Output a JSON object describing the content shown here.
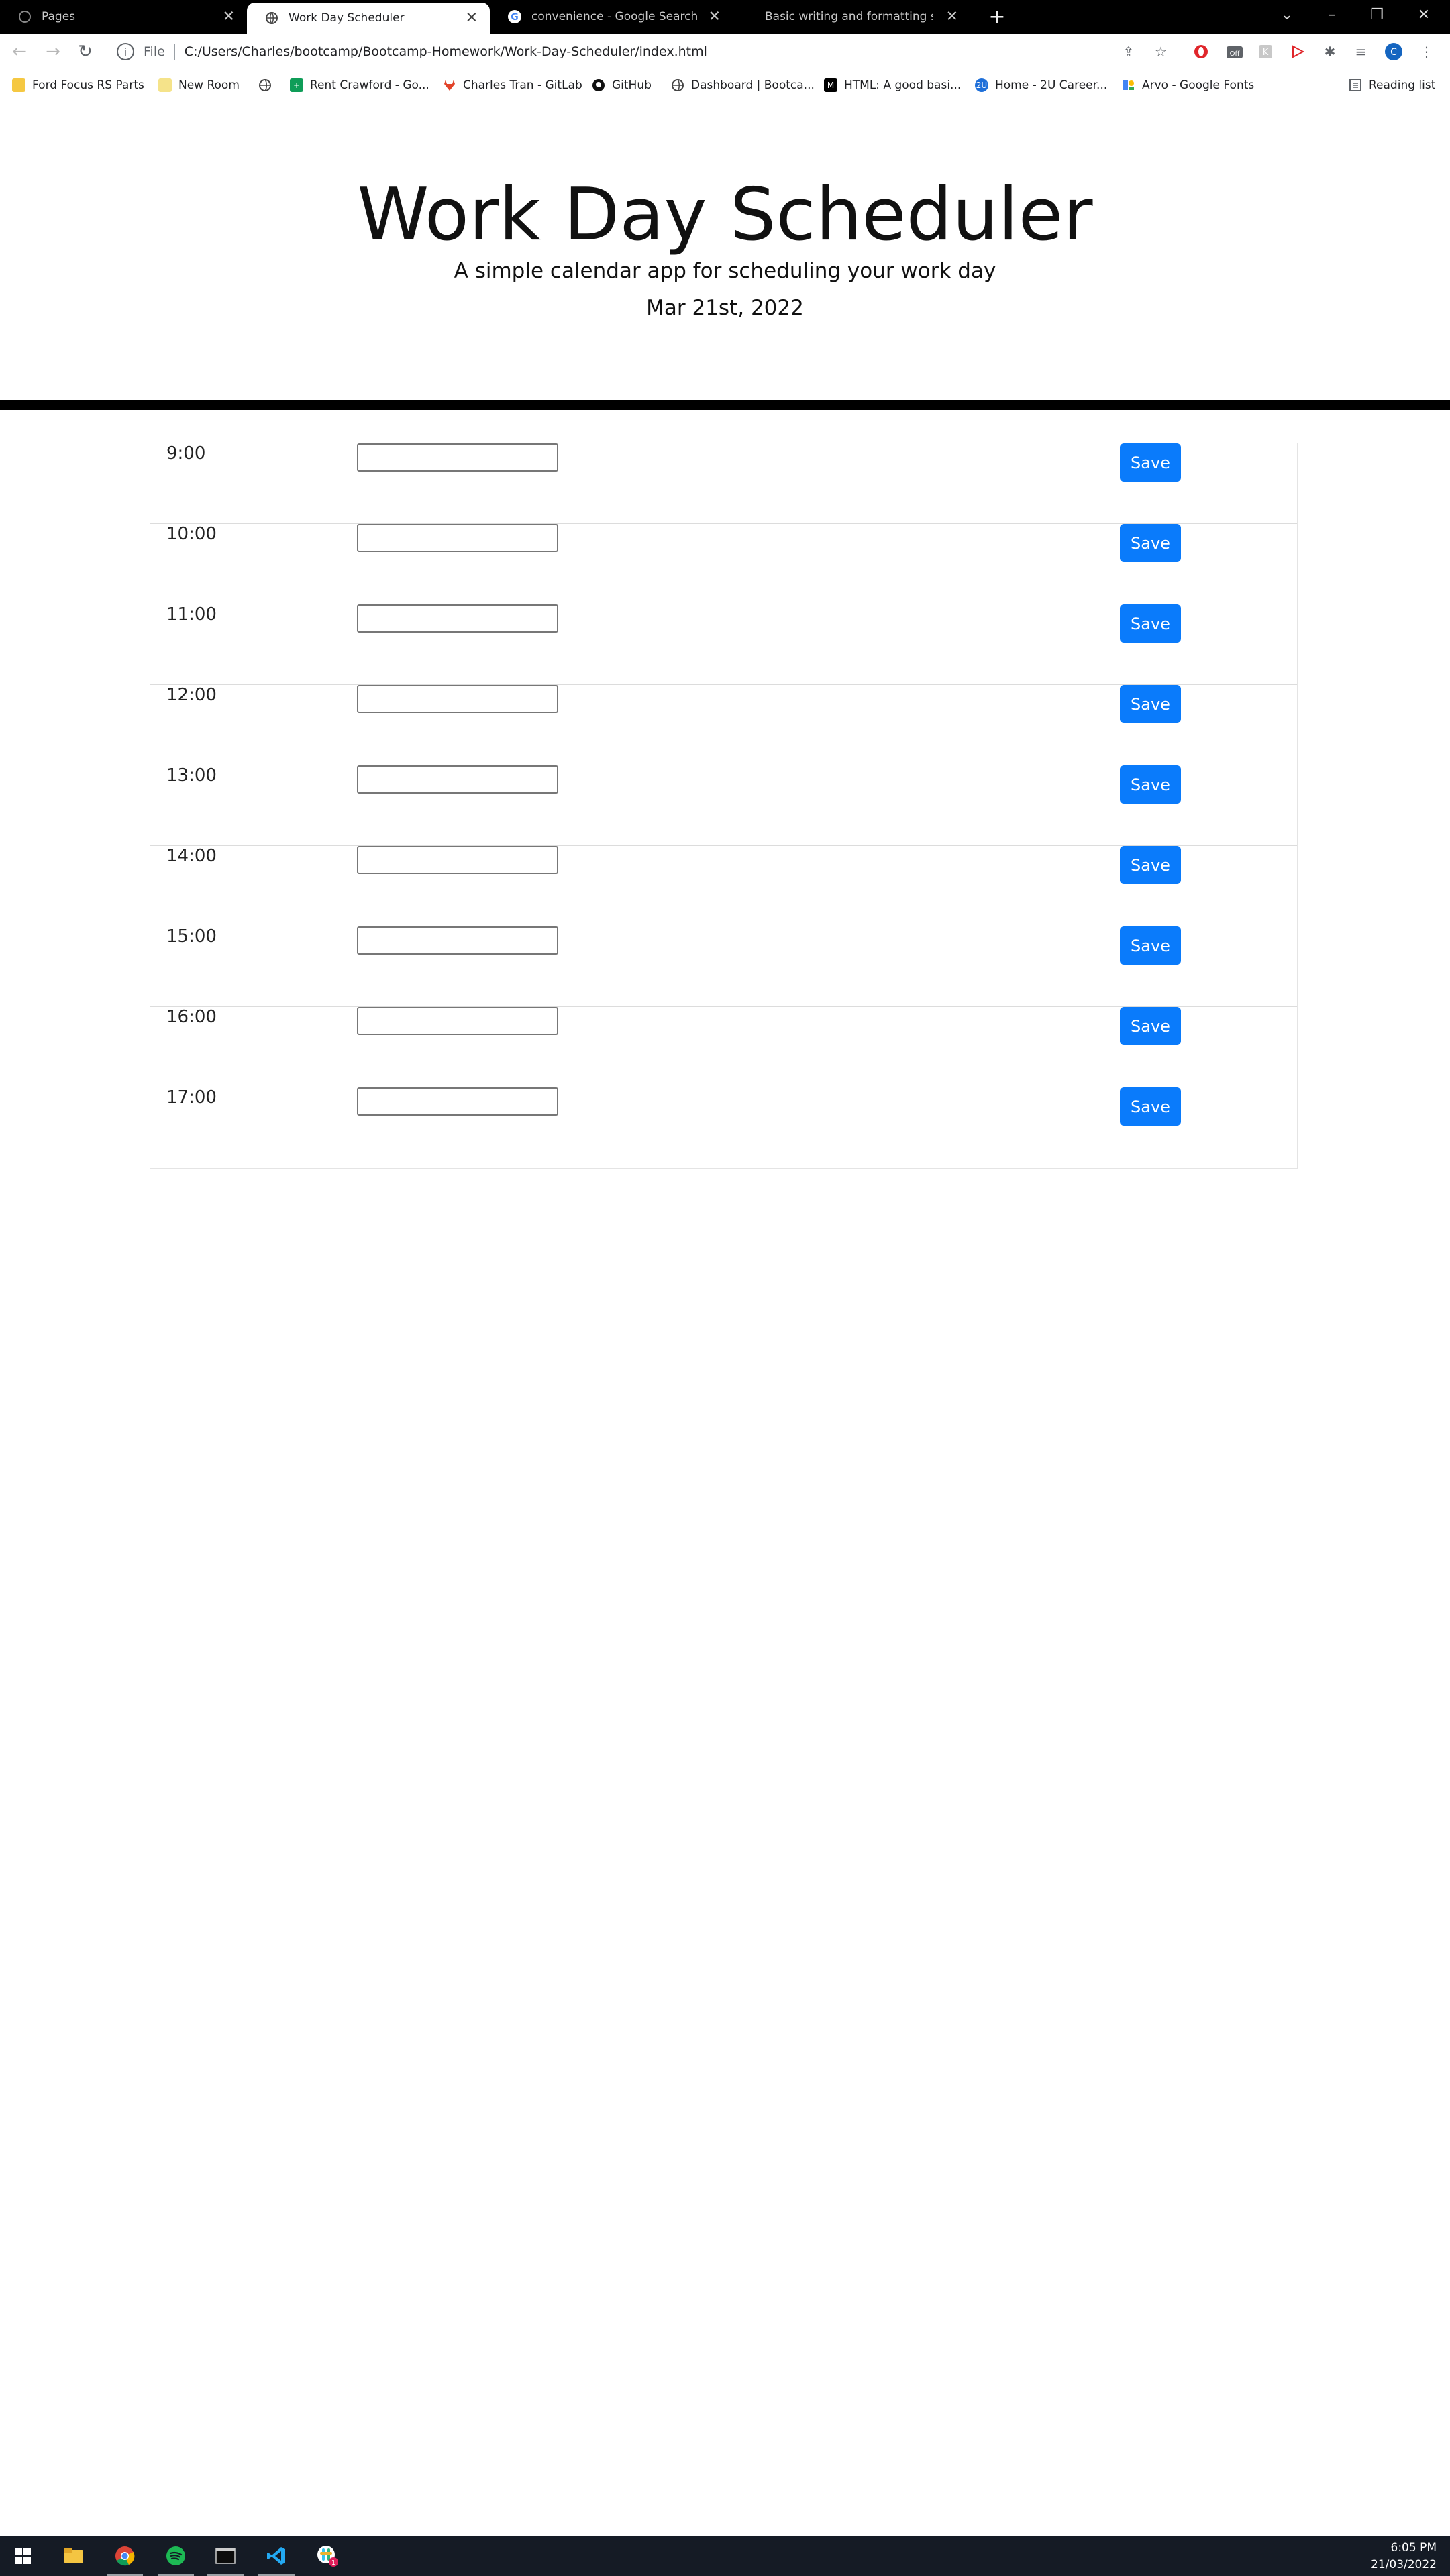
{
  "browser": {
    "tabs": [
      {
        "title": "Pages",
        "active": false
      },
      {
        "title": "Work Day Scheduler",
        "active": true
      },
      {
        "title": "convenience - Google Search",
        "active": false
      },
      {
        "title": "Basic writing and formatting syn",
        "active": false
      }
    ],
    "address": {
      "scheme_label": "File",
      "url": "C:/Users/Charles/bootcamp/Bootcamp-Homework/Work-Day-Scheduler/index.html"
    },
    "bookmarks": [
      {
        "label": "Ford Focus RS Parts",
        "icon": "folder-icon"
      },
      {
        "label": "New Room",
        "icon": "folder-icon"
      },
      {
        "label": "",
        "icon": "globe-icon"
      },
      {
        "label": "Rent Crawford - Go...",
        "icon": "sheets-icon"
      },
      {
        "label": "Charles Tran - GitLab",
        "icon": "gitlab-icon"
      },
      {
        "label": "GitHub",
        "icon": "github-icon"
      },
      {
        "label": "Dashboard | Bootca...",
        "icon": "globe-icon"
      },
      {
        "label": "HTML: A good basi...",
        "icon": "mdn-icon"
      },
      {
        "label": "Home - 2U Career...",
        "icon": "2u-icon"
      },
      {
        "label": "Arvo - Google Fonts",
        "icon": "google-fonts-icon"
      }
    ],
    "reading_list_label": "Reading list",
    "profile_initial": "C"
  },
  "header": {
    "title": "Work Day Scheduler",
    "subtitle": "A simple calendar app for scheduling your work day",
    "current_day": "Mar 21st, 2022"
  },
  "schedule": {
    "hours": [
      "9:00",
      "10:00",
      "11:00",
      "12:00",
      "13:00",
      "14:00",
      "15:00",
      "16:00",
      "17:00"
    ],
    "entries": [
      "",
      "",
      "",
      "",
      "",
      "",
      "",
      "",
      ""
    ],
    "save_label": "Save"
  },
  "taskbar": {
    "apps": [
      "start-icon",
      "file-explorer-icon",
      "chrome-icon",
      "spotify-icon",
      "terminal-icon",
      "vscode-icon",
      "slack-icon"
    ],
    "badge_count": "1",
    "time": "6:05 PM",
    "date": "21/03/2022"
  },
  "colors": {
    "save_button": "#0a7bfb",
    "divider": "#000000",
    "tabstrip": "#000000",
    "taskbar": "#151b25"
  }
}
